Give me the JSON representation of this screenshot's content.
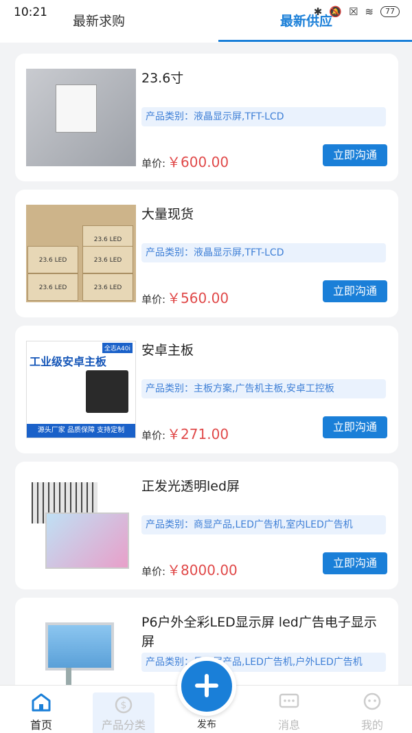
{
  "status": {
    "time": "10:21",
    "battery": "77"
  },
  "tabs": {
    "left": "最新求购",
    "right": "最新供应"
  },
  "items": [
    {
      "title": "23.6寸",
      "category": "产品类别：液晶显示屏,TFT-LCD",
      "price_label": "单价:",
      "price": "￥600.00",
      "button": "立即沟通"
    },
    {
      "title": "大量现货",
      "category": "产品类别：液晶显示屏,TFT-LCD",
      "price_label": "单价:",
      "price": "￥560.00",
      "button": "立即沟通"
    },
    {
      "title": "安卓主板",
      "category": "产品类别：主板方案,广告机主板,安卓工控板",
      "price_label": "单价:",
      "price": "￥271.00",
      "button": "立即沟通",
      "image_text": {
        "header": "工业级安卓主板",
        "badge": "全志A40i",
        "footer": "源头厂家 品质保障 支持定制"
      }
    },
    {
      "title": "正发光透明led屏",
      "category": "产品类别：商显产品,LED广告机,室内LED广告机",
      "price_label": "单价:",
      "price": "￥8000.00",
      "button": "立即沟通"
    },
    {
      "title": "P6户外全彩LED显示屏 led广告电子显示屏",
      "category": "产品类别：显示屏产品,LED广告机,户外LED广告机"
    }
  ],
  "box_labels": [
    "23.6 LED",
    "23.6 LED",
    "23.6 LED",
    "23.6 LED",
    "23.6 LED"
  ],
  "nav": {
    "home": "首页",
    "category": "产品分类",
    "publish": "发布",
    "messages": "消息",
    "mine": "我的"
  },
  "colors": {
    "accent": "#1a7fd8",
    "price": "#e04848",
    "category_bg": "#eaf2fd"
  }
}
